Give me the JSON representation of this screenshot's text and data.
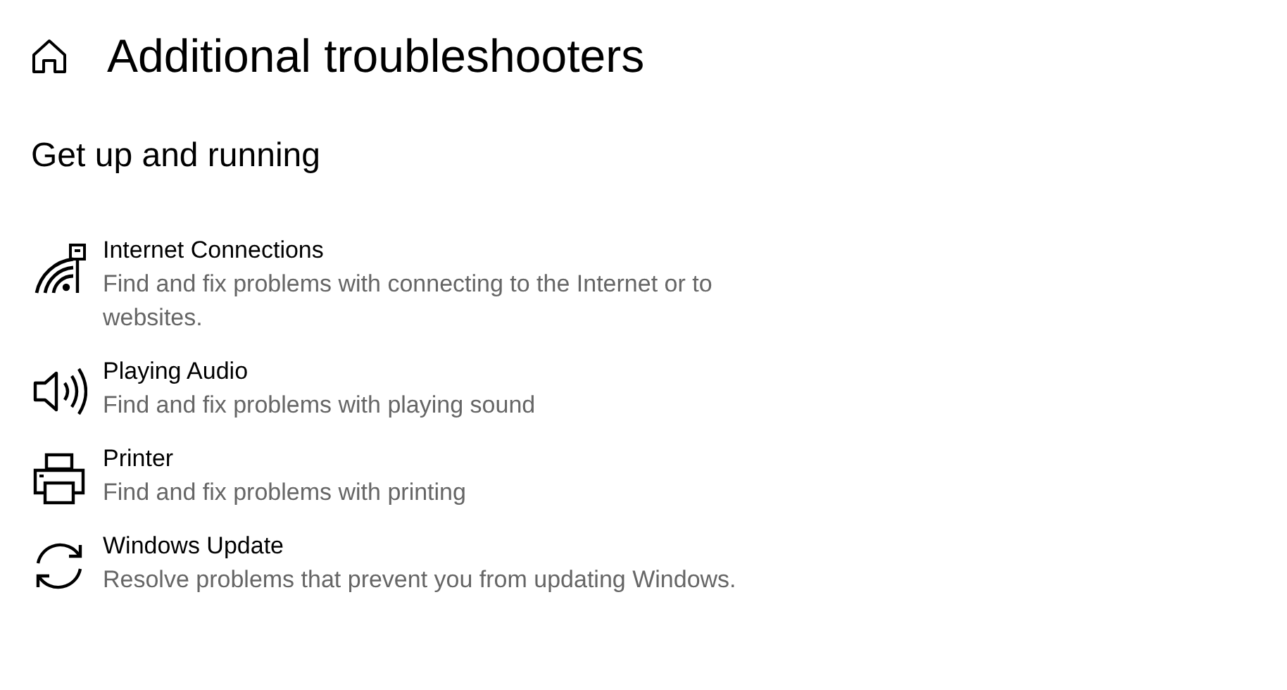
{
  "page": {
    "title": "Additional troubleshooters"
  },
  "section": {
    "heading": "Get up and running"
  },
  "items": [
    {
      "kind": "network",
      "title": "Internet Connections",
      "description": "Find and fix problems with connecting to the Internet or to websites."
    },
    {
      "kind": "audio",
      "title": "Playing Audio",
      "description": "Find and fix problems with playing sound"
    },
    {
      "kind": "printer",
      "title": "Printer",
      "description": "Find and fix problems with printing"
    },
    {
      "kind": "update",
      "title": "Windows Update",
      "description": "Resolve problems that prevent you from updating Windows."
    }
  ]
}
